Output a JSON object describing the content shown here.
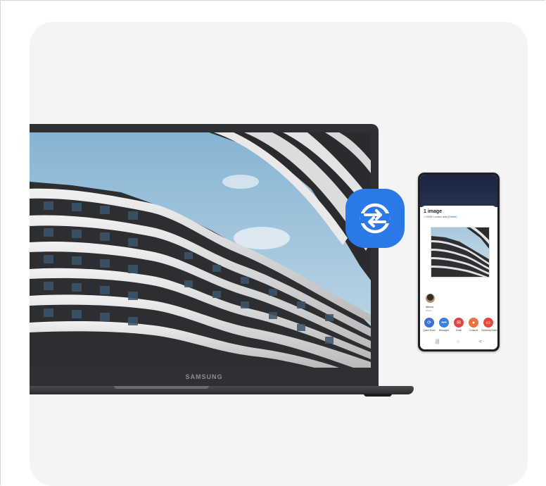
{
  "laptop": {
    "brand": "SAMSUNG",
    "wallpaper": "curved-balcony-building-sky"
  },
  "quick_share": {
    "icon": "quick-share-icon",
    "color": "#2b78e8"
  },
  "phone": {
    "share_sheet": {
      "title": "1 image",
      "subtitle_prefix": "1.00MB Location data",
      "subtitle_link": "(Delete)"
    },
    "contact": {
      "name": "Athena",
      "sub": "Phone"
    },
    "apps": [
      {
        "label": "Quick Share",
        "icon": "quick-share-icon",
        "color": "#3b6fd6"
      },
      {
        "label": "Messages",
        "icon": "messages-icon",
        "color": "#3b7de0"
      },
      {
        "label": "Email",
        "icon": "email-icon",
        "color": "#e04444"
      },
      {
        "label": "Contacts",
        "icon": "contacts-icon",
        "color": "#f06f3d"
      },
      {
        "label": "Samsung Notes",
        "icon": "notes-icon",
        "color": "#e8483b"
      }
    ],
    "nav": [
      "|||",
      "○",
      "<"
    ]
  }
}
